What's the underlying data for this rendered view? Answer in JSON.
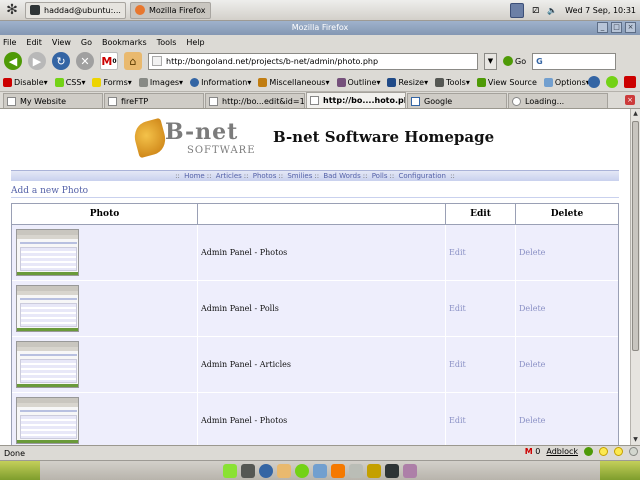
{
  "desktop": {
    "tasks": [
      {
        "label": "haddad@ubuntu:...",
        "active": false
      },
      {
        "label": "Mozilla Firefox",
        "active": true
      }
    ],
    "clock": "Wed 7 Sep, 10:31"
  },
  "window": {
    "title": "Mozilla Firefox"
  },
  "menubar": [
    "File",
    "Edit",
    "View",
    "Go",
    "Bookmarks",
    "Tools",
    "Help"
  ],
  "navbar": {
    "url": "http://bongoland.net/projects/b-net/admin/photo.php",
    "go_label": "Go",
    "search_placeholder": "",
    "gmail_count": "0"
  },
  "devbar": [
    "Disable▾",
    "CSS▾",
    "Forms▾",
    "Images▾",
    "Information▾",
    "Miscellaneous▾",
    "Outline▾",
    "Resize▾",
    "Tools▾",
    "View Source",
    "Options▾"
  ],
  "tabs": [
    {
      "label": "My Website",
      "selected": false
    },
    {
      "label": "fireFTP",
      "selected": false
    },
    {
      "label": "http://bo...edit&id=1",
      "selected": false
    },
    {
      "label": "http://bo....hoto.php",
      "selected": true
    },
    {
      "label": "Google",
      "selected": false
    },
    {
      "label": "Loading...",
      "selected": false
    }
  ],
  "page": {
    "logo_main": "B-net",
    "logo_sub": "SOFTWARE",
    "site_title": "B-net Software Homepage",
    "nav_prefix": "::",
    "nav_suffix": "::",
    "nav_links": [
      "Home",
      "Articles",
      "Photos",
      "Smilies",
      "Bad Words",
      "Polls",
      "Configuration"
    ],
    "add_new": "Add a new Photo",
    "table": {
      "headers": [
        "Photo",
        "",
        "Edit",
        "Delete"
      ],
      "rows": [
        {
          "title": "Admin Panel - Photos",
          "edit": "Edit",
          "delete": "Delete"
        },
        {
          "title": "Admin Panel - Polls",
          "edit": "Edit",
          "delete": "Delete"
        },
        {
          "title": "Admin Panel - Articles",
          "edit": "Edit",
          "delete": "Delete"
        },
        {
          "title": "Admin Panel - Photos",
          "edit": "Edit",
          "delete": "Delete"
        }
      ]
    }
  },
  "statusbar": {
    "text": "Done",
    "gmail": "M",
    "gmail_count": "0",
    "adblock": "Adblock"
  }
}
